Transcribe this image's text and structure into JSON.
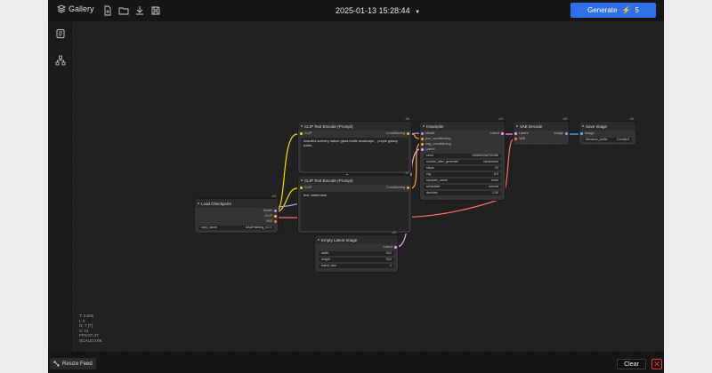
{
  "topbar": {
    "gallery_label": "Gallery",
    "timestamp": "2025-01-13 15:28:44",
    "generate_label": "Generate",
    "generate_count": "5"
  },
  "nodes": {
    "clip1": {
      "title": "CLIP Text Encode (Prompt)",
      "id": "#6",
      "in_clip": "CLIP",
      "out_cond": "Conditioning",
      "text": "beautiful scenery nature glass bottle landscape, , purple galaxy bottle,"
    },
    "clip2": {
      "title": "CLIP Text Encode (Prompt)",
      "id": "#7",
      "in_clip": "CLIP",
      "out_cond": "Conditioning",
      "text": "text, watermark"
    },
    "ksampler": {
      "title": "KSampler",
      "id": "#3",
      "out_latent": "Latent",
      "inputs": [
        "Model",
        "pos_conditioning",
        "neg_conditioning",
        "Latent"
      ],
      "widgets": [
        {
          "label": "seed",
          "value": "156680208700286"
        },
        {
          "label": "control_after_generate",
          "value": "randomize"
        },
        {
          "label": "steps",
          "value": "20"
        },
        {
          "label": "cfg",
          "value": "8.0"
        },
        {
          "label": "sampler_name",
          "value": "euler"
        },
        {
          "label": "scheduler",
          "value": "normal"
        },
        {
          "label": "denoise",
          "value": "1.00"
        }
      ]
    },
    "vae": {
      "title": "VAE Decode",
      "id": "#8",
      "in_latent": "Latent",
      "in_vae": "VAE",
      "out_image": "Image"
    },
    "save": {
      "title": "Save Image",
      "id": "#9",
      "in_image": "Image",
      "w_label": "filename_prefix",
      "w_value": "ComfyUI"
    },
    "ckpt": {
      "title": "Load Checkpoint",
      "id": "#4",
      "outputs": [
        "Model",
        "CLIP",
        "VAE"
      ],
      "w_label": "ckpt_name",
      "w_value": "AAAPainting_v1.3"
    },
    "latent": {
      "title": "Empty Latent Image",
      "id": "#5",
      "out_latent": "Latent",
      "widgets": [
        {
          "label": "width",
          "value": "512"
        },
        {
          "label": "height",
          "value": "512"
        },
        {
          "label": "batch_size",
          "value": "1"
        }
      ]
    }
  },
  "stats": [
    "T: 0.00s",
    "I: 0",
    "N: 7 [7]",
    "V: 14",
    "FPS:67.47",
    "SCALE:0.66"
  ],
  "bottombar": {
    "resize_label": "Resize Feed",
    "clear_label": "Clear"
  },
  "colors": {
    "accent": "#2f6fe8",
    "model": "#b39ddb",
    "clip": "#ffd500",
    "vae": "#ff6e6e",
    "conditioning": "#ffa931",
    "latent": "#ff9cf9",
    "image": "#64b5f6"
  }
}
